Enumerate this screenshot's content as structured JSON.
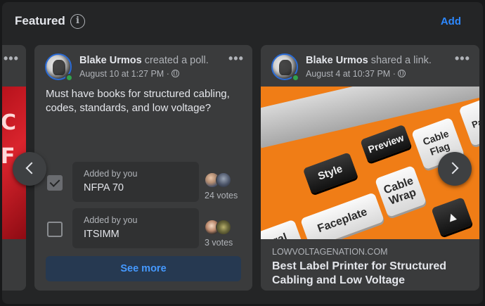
{
  "header": {
    "title": "Featured",
    "info_glyph": "i",
    "add_label": "Add"
  },
  "poll_card": {
    "author": "Blake Urmos",
    "action": "created a poll.",
    "date": "August 10 at 1:27 PM",
    "question": "Must have books for structured cabling, codes, standards, and low voltage?",
    "options": [
      {
        "added_by": "Added by you",
        "label": "NFPA 70",
        "votes": "24 votes",
        "checked": true
      },
      {
        "added_by": "Added by you",
        "label": "ITSIMM",
        "votes": "3 votes",
        "checked": false
      }
    ],
    "see_more": "See more"
  },
  "link_card": {
    "author": "Blake Urmos",
    "action": "shared a link.",
    "date": "August 4 at 10:37 PM",
    "domain": "LOWVOLTAGENATION.COM",
    "title": "Best Label Printer for Structured Cabling and Low Voltage",
    "image_keys": [
      "Style",
      "Preview",
      "Cable Flag",
      "Pat",
      "Faceplate",
      "Cable Wrap",
      "neral"
    ]
  },
  "icons": {
    "more": "more-dots-icon",
    "globe": "globe-icon",
    "info": "info-icon",
    "prev": "chevron-left-icon",
    "next": "chevron-right-icon"
  },
  "colors": {
    "accent": "#2d88ff",
    "panel": "#242526",
    "card": "#3a3b3c",
    "see_more_bg": "#263951"
  }
}
